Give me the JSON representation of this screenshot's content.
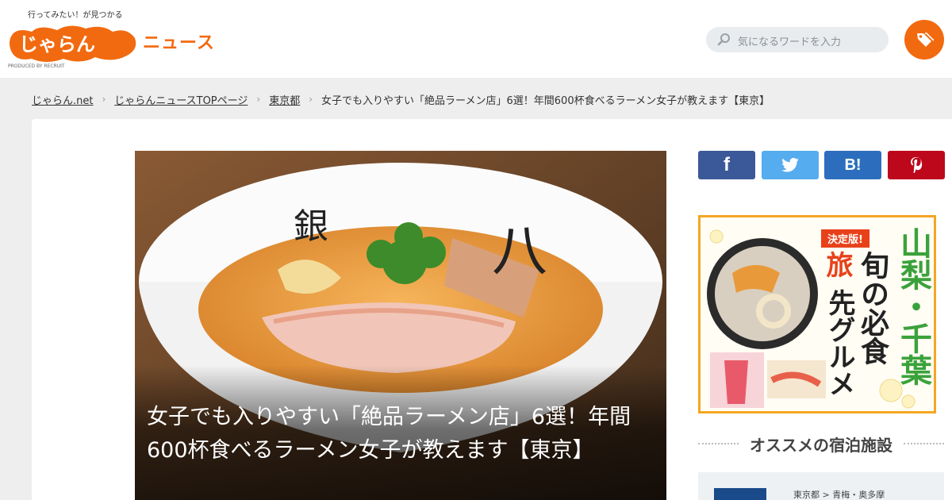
{
  "header": {
    "tagline": "行ってみたい！が見つかる",
    "brand_name": "じゃらん",
    "brand_suffix": "ニュース",
    "produced_by": "PRODUCED BY RECRUIT",
    "search_placeholder": "気になるワードを入力"
  },
  "breadcrumb": [
    {
      "label": "じゃらん.net"
    },
    {
      "label": "じゃらんニュースTOPページ"
    },
    {
      "label": "東京都"
    },
    {
      "label": "女子でも入りやすい「絶品ラーメン店」6選！年間600杯食べるラーメン女子が教えます【東京】"
    }
  ],
  "breadcrumb_separator": "›",
  "article": {
    "title": "女子でも入りやすい「絶品ラーメン店」6選！年間600杯食べるラーメン女子が教えます【東京】"
  },
  "share": {
    "facebook": "f",
    "hatena": "B!"
  },
  "banner": {
    "badge": "決定版!",
    "region": "山梨・千葉",
    "line1": "旬の必食",
    "line2": "旅",
    "line3": "先グルメ"
  },
  "recommend": {
    "heading": "オススメの宿泊施設",
    "items": [
      {
        "location": "東京都 > 青梅・奥多摩"
      }
    ]
  },
  "colors": {
    "brand_orange": "#f26a0f",
    "facebook": "#3b5998",
    "twitter": "#55acee",
    "hatena": "#2c6ebd",
    "pinterest": "#bd081c"
  }
}
